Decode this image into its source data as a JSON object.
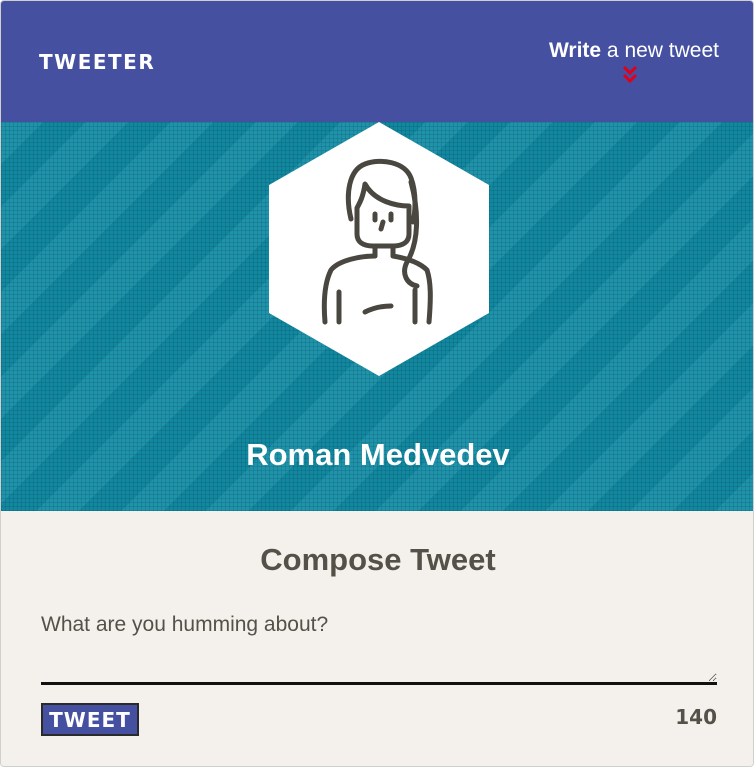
{
  "nav": {
    "brand": "TWEETER",
    "compose_link_strong": "Write",
    "compose_link_rest": " a new tweet",
    "accent_color": "#e0001b",
    "background_color": "#4550a1"
  },
  "profile": {
    "name": "Roman Medvedev",
    "avatar_icon": "woman-avatar-icon",
    "banner_color": "#128da6"
  },
  "compose": {
    "title": "Compose Tweet",
    "placeholder": "What are you humming about?",
    "submit_label": "TWEET",
    "char_counter": "140"
  }
}
